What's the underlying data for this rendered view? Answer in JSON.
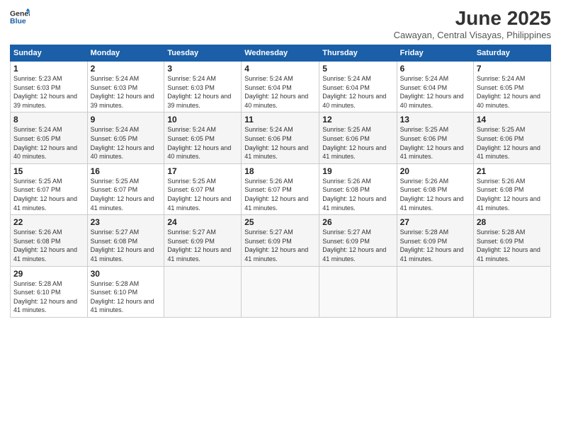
{
  "header": {
    "logo_general": "General",
    "logo_blue": "Blue",
    "title": "June 2025",
    "subtitle": "Cawayan, Central Visayas, Philippines"
  },
  "columns": [
    "Sunday",
    "Monday",
    "Tuesday",
    "Wednesday",
    "Thursday",
    "Friday",
    "Saturday"
  ],
  "weeks": [
    [
      {
        "day": "1",
        "sunrise": "5:23 AM",
        "sunset": "6:03 PM",
        "daylight": "12 hours and 39 minutes."
      },
      {
        "day": "2",
        "sunrise": "5:24 AM",
        "sunset": "6:03 PM",
        "daylight": "12 hours and 39 minutes."
      },
      {
        "day": "3",
        "sunrise": "5:24 AM",
        "sunset": "6:03 PM",
        "daylight": "12 hours and 39 minutes."
      },
      {
        "day": "4",
        "sunrise": "5:24 AM",
        "sunset": "6:04 PM",
        "daylight": "12 hours and 40 minutes."
      },
      {
        "day": "5",
        "sunrise": "5:24 AM",
        "sunset": "6:04 PM",
        "daylight": "12 hours and 40 minutes."
      },
      {
        "day": "6",
        "sunrise": "5:24 AM",
        "sunset": "6:04 PM",
        "daylight": "12 hours and 40 minutes."
      },
      {
        "day": "7",
        "sunrise": "5:24 AM",
        "sunset": "6:05 PM",
        "daylight": "12 hours and 40 minutes."
      }
    ],
    [
      {
        "day": "8",
        "sunrise": "5:24 AM",
        "sunset": "6:05 PM",
        "daylight": "12 hours and 40 minutes."
      },
      {
        "day": "9",
        "sunrise": "5:24 AM",
        "sunset": "6:05 PM",
        "daylight": "12 hours and 40 minutes."
      },
      {
        "day": "10",
        "sunrise": "5:24 AM",
        "sunset": "6:05 PM",
        "daylight": "12 hours and 40 minutes."
      },
      {
        "day": "11",
        "sunrise": "5:24 AM",
        "sunset": "6:06 PM",
        "daylight": "12 hours and 41 minutes."
      },
      {
        "day": "12",
        "sunrise": "5:25 AM",
        "sunset": "6:06 PM",
        "daylight": "12 hours and 41 minutes."
      },
      {
        "day": "13",
        "sunrise": "5:25 AM",
        "sunset": "6:06 PM",
        "daylight": "12 hours and 41 minutes."
      },
      {
        "day": "14",
        "sunrise": "5:25 AM",
        "sunset": "6:06 PM",
        "daylight": "12 hours and 41 minutes."
      }
    ],
    [
      {
        "day": "15",
        "sunrise": "5:25 AM",
        "sunset": "6:07 PM",
        "daylight": "12 hours and 41 minutes."
      },
      {
        "day": "16",
        "sunrise": "5:25 AM",
        "sunset": "6:07 PM",
        "daylight": "12 hours and 41 minutes."
      },
      {
        "day": "17",
        "sunrise": "5:25 AM",
        "sunset": "6:07 PM",
        "daylight": "12 hours and 41 minutes."
      },
      {
        "day": "18",
        "sunrise": "5:26 AM",
        "sunset": "6:07 PM",
        "daylight": "12 hours and 41 minutes."
      },
      {
        "day": "19",
        "sunrise": "5:26 AM",
        "sunset": "6:08 PM",
        "daylight": "12 hours and 41 minutes."
      },
      {
        "day": "20",
        "sunrise": "5:26 AM",
        "sunset": "6:08 PM",
        "daylight": "12 hours and 41 minutes."
      },
      {
        "day": "21",
        "sunrise": "5:26 AM",
        "sunset": "6:08 PM",
        "daylight": "12 hours and 41 minutes."
      }
    ],
    [
      {
        "day": "22",
        "sunrise": "5:26 AM",
        "sunset": "6:08 PM",
        "daylight": "12 hours and 41 minutes."
      },
      {
        "day": "23",
        "sunrise": "5:27 AM",
        "sunset": "6:08 PM",
        "daylight": "12 hours and 41 minutes."
      },
      {
        "day": "24",
        "sunrise": "5:27 AM",
        "sunset": "6:09 PM",
        "daylight": "12 hours and 41 minutes."
      },
      {
        "day": "25",
        "sunrise": "5:27 AM",
        "sunset": "6:09 PM",
        "daylight": "12 hours and 41 minutes."
      },
      {
        "day": "26",
        "sunrise": "5:27 AM",
        "sunset": "6:09 PM",
        "daylight": "12 hours and 41 minutes."
      },
      {
        "day": "27",
        "sunrise": "5:28 AM",
        "sunset": "6:09 PM",
        "daylight": "12 hours and 41 minutes."
      },
      {
        "day": "28",
        "sunrise": "5:28 AM",
        "sunset": "6:09 PM",
        "daylight": "12 hours and 41 minutes."
      }
    ],
    [
      {
        "day": "29",
        "sunrise": "5:28 AM",
        "sunset": "6:10 PM",
        "daylight": "12 hours and 41 minutes."
      },
      {
        "day": "30",
        "sunrise": "5:28 AM",
        "sunset": "6:10 PM",
        "daylight": "12 hours and 41 minutes."
      },
      null,
      null,
      null,
      null,
      null
    ]
  ]
}
